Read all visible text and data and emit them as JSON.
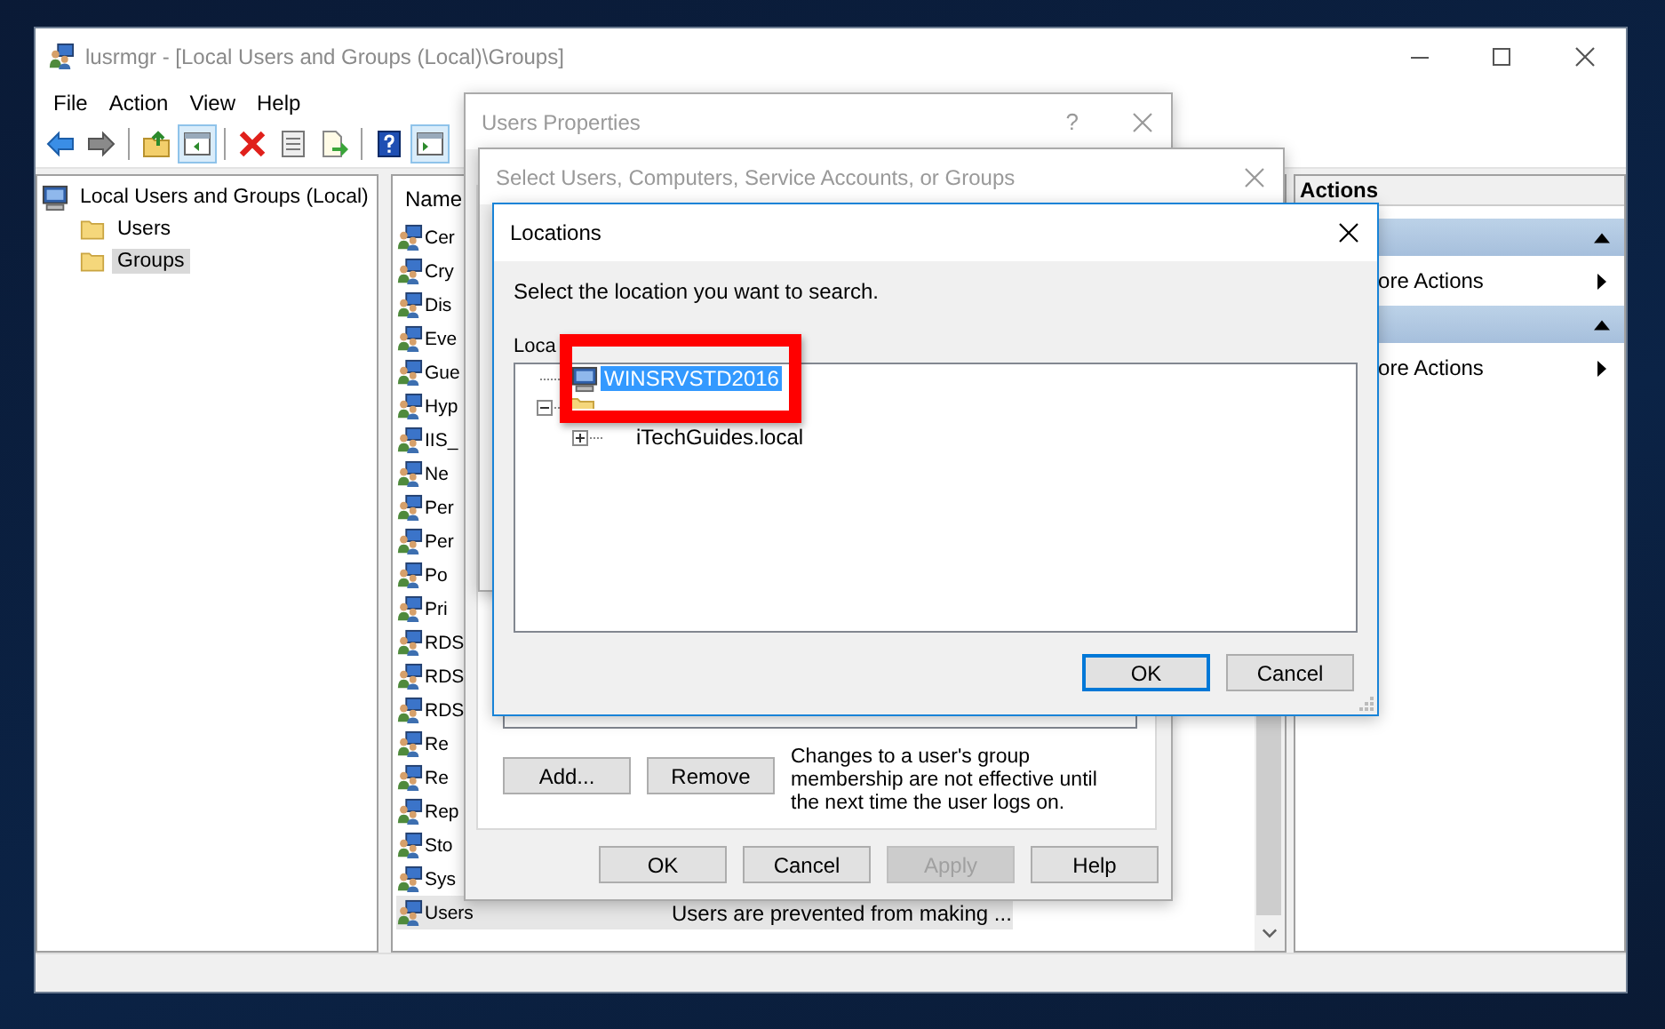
{
  "window": {
    "title": "lusrmgr - [Local Users and Groups (Local)\\Groups]"
  },
  "menu": [
    "File",
    "Action",
    "View",
    "Help"
  ],
  "toolbar": [
    [
      {
        "kind": "back",
        "on": false
      },
      {
        "kind": "forward",
        "on": false
      }
    ],
    [
      {
        "kind": "up",
        "on": false
      },
      {
        "kind": "tree-pane",
        "on": true
      }
    ],
    [
      {
        "kind": "delete",
        "on": false
      },
      {
        "kind": "properties",
        "on": false
      },
      {
        "kind": "export",
        "on": false
      }
    ],
    [
      {
        "kind": "help",
        "on": false
      },
      {
        "kind": "action-pane",
        "on": true
      }
    ]
  ],
  "tree": {
    "label": "Local Users and Groups (Local)",
    "children": [
      {
        "label": "Users",
        "selected": false
      },
      {
        "label": "Groups",
        "selected": true
      }
    ]
  },
  "list": {
    "columns": [
      "Name"
    ],
    "rows": [
      {
        "name": "Cer",
        "selected": false
      },
      {
        "name": "Cry",
        "selected": false
      },
      {
        "name": "Dis",
        "selected": false
      },
      {
        "name": "Eve",
        "selected": false
      },
      {
        "name": "Gue",
        "selected": false
      },
      {
        "name": "Hyp",
        "selected": false
      },
      {
        "name": "IIS_",
        "selected": false
      },
      {
        "name": "Ne",
        "selected": false
      },
      {
        "name": "Per",
        "selected": false
      },
      {
        "name": "Per",
        "selected": false
      },
      {
        "name": "Po",
        "selected": false
      },
      {
        "name": "Pri",
        "selected": false
      },
      {
        "name": "RDS",
        "selected": false
      },
      {
        "name": "RDS",
        "selected": false
      },
      {
        "name": "RDS",
        "selected": false
      },
      {
        "name": "Re",
        "selected": false
      },
      {
        "name": "Re",
        "selected": false
      },
      {
        "name": "Rep",
        "selected": false
      },
      {
        "name": "Sto",
        "selected": false
      },
      {
        "name": "Sys",
        "selected": false
      },
      {
        "name": "Users",
        "description": "Users are prevented from making ...",
        "selected": true
      }
    ]
  },
  "actions": {
    "title": "Actions",
    "sections": [
      {
        "item": "ore Actions"
      },
      {
        "item": "ore Actions"
      }
    ]
  },
  "users_properties": {
    "title": "Users Properties",
    "help": "?",
    "add": "Add...",
    "remove": "Remove",
    "note": "Changes to a user's group membership are not effective until the next time the user logs on.",
    "buttons": [
      {
        "label": "OK",
        "disabled": false
      },
      {
        "label": "Cancel",
        "disabled": false
      },
      {
        "label": "Apply",
        "disabled": true
      },
      {
        "label": "Help",
        "disabled": false
      }
    ]
  },
  "select_dialog": {
    "title": "Select Users, Computers, Service Accounts, or Groups"
  },
  "locations": {
    "title": "Locations",
    "prompt": "Select the location you want to search.",
    "label": "Loca",
    "tree": [
      {
        "kind": "computer",
        "label": "WINSRVSTD2016",
        "selected": true
      },
      {
        "kind": "folder",
        "expanded": true,
        "children": [
          {
            "label": "iTechGuides.local",
            "expanded": false,
            "selected": false
          }
        ]
      }
    ],
    "buttons": [
      {
        "label": "OK",
        "default": true
      },
      {
        "label": "Cancel",
        "default": false
      }
    ]
  }
}
